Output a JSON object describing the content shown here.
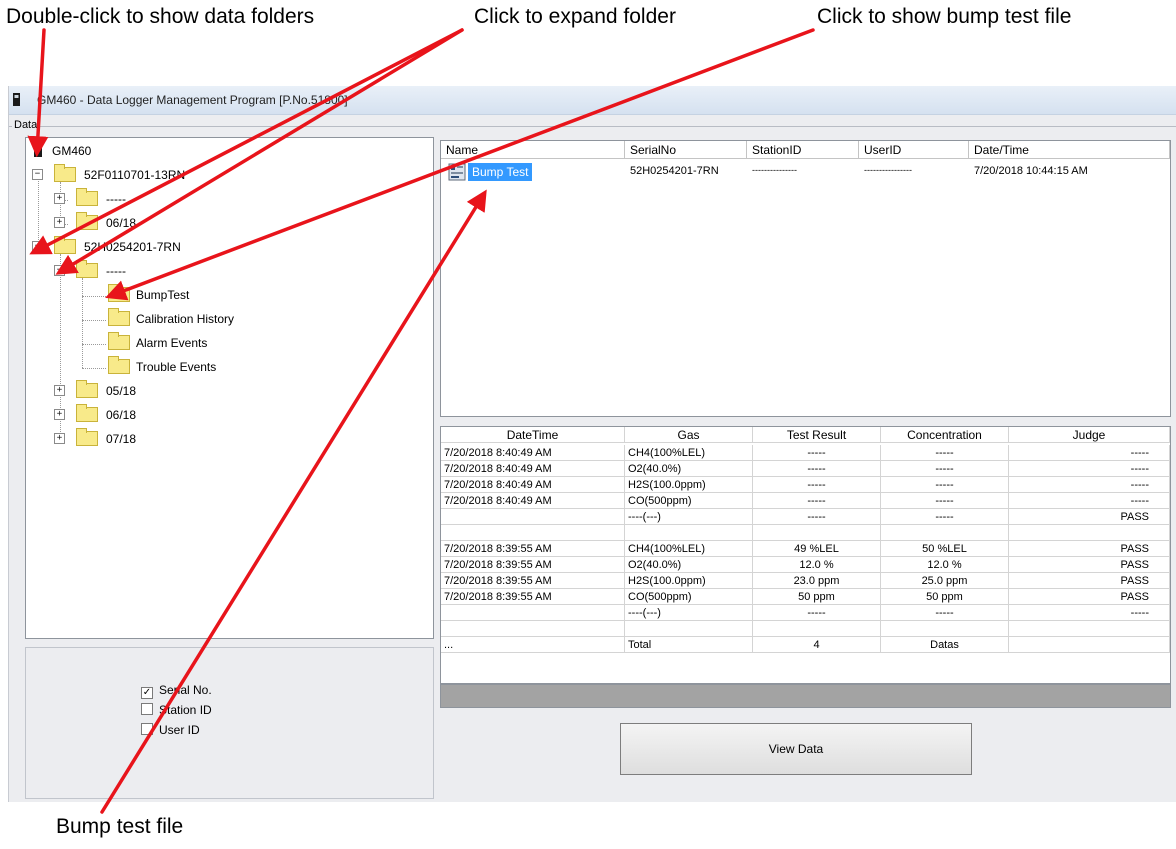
{
  "annotations": {
    "double_click": "Double-click to show data folders",
    "expand_folder": "Click to expand folder",
    "show_bump": "Click to show bump test file",
    "bump_file": "Bump test file"
  },
  "window": {
    "title": "GM460 - Data Logger Management Program [P.No.51800]",
    "group_label": "Data"
  },
  "tree": {
    "root": "GM460",
    "serial_1": "52F0110701-13RN",
    "serial_1_children": [
      "-----",
      "06/18"
    ],
    "serial_2": "52H0254201-7RN",
    "serial_2_folder": "-----",
    "sub_folders": [
      "BumpTest",
      "Calibration History",
      "Alarm Events",
      "Trouble Events"
    ],
    "months": [
      "05/18",
      "06/18",
      "07/18"
    ]
  },
  "filters": [
    {
      "label": "Serial No.",
      "checked": true
    },
    {
      "label": "Station ID",
      "checked": false
    },
    {
      "label": "User ID",
      "checked": false
    }
  ],
  "file_list": {
    "columns": [
      "Name",
      "SerialNo",
      "StationID",
      "UserID",
      "Date/Time"
    ],
    "row": {
      "name": "Bump Test",
      "serial": "52H0254201-7RN",
      "station": "---------------",
      "user": "----------------",
      "datetime": "7/20/2018 10:44:15 AM"
    }
  },
  "results": {
    "columns": [
      "DateTime",
      "Gas",
      "Test Result",
      "Concentration",
      "Judge"
    ],
    "rows": [
      [
        "7/20/2018 8:40:49 AM",
        "CH4(100%LEL)",
        "-----",
        "-----",
        "-----"
      ],
      [
        "7/20/2018 8:40:49 AM",
        "O2(40.0%)",
        "-----",
        "-----",
        "-----"
      ],
      [
        "7/20/2018 8:40:49 AM",
        "H2S(100.0ppm)",
        "-----",
        "-----",
        "-----"
      ],
      [
        "7/20/2018 8:40:49 AM",
        "CO(500ppm)",
        "-----",
        "-----",
        "-----"
      ],
      [
        "",
        "----(---)",
        "-----",
        "-----",
        "PASS"
      ],
      [
        "",
        "",
        "",
        "",
        ""
      ],
      [
        "7/20/2018 8:39:55 AM",
        "CH4(100%LEL)",
        "49 %LEL",
        "50 %LEL",
        "PASS"
      ],
      [
        "7/20/2018 8:39:55 AM",
        "O2(40.0%)",
        "12.0 %",
        "12.0 %",
        "PASS"
      ],
      [
        "7/20/2018 8:39:55 AM",
        "H2S(100.0ppm)",
        "23.0 ppm",
        "25.0 ppm",
        "PASS"
      ],
      [
        "7/20/2018 8:39:55 AM",
        "CO(500ppm)",
        "50 ppm",
        "50 ppm",
        "PASS"
      ],
      [
        "",
        "----(---)",
        "-----",
        "-----",
        "-----"
      ],
      [
        "",
        "",
        "",
        "",
        ""
      ],
      [
        "...",
        "Total",
        "4",
        "Datas",
        ""
      ]
    ]
  },
  "buttons": {
    "view_data": "View Data"
  },
  "colors": {
    "arrow": "#e8141b",
    "selection": "#3399ff",
    "folder": "#f8ea8a"
  },
  "icons": {
    "device": "device-icon",
    "folder": "folder-icon",
    "file": "data-file-icon"
  }
}
